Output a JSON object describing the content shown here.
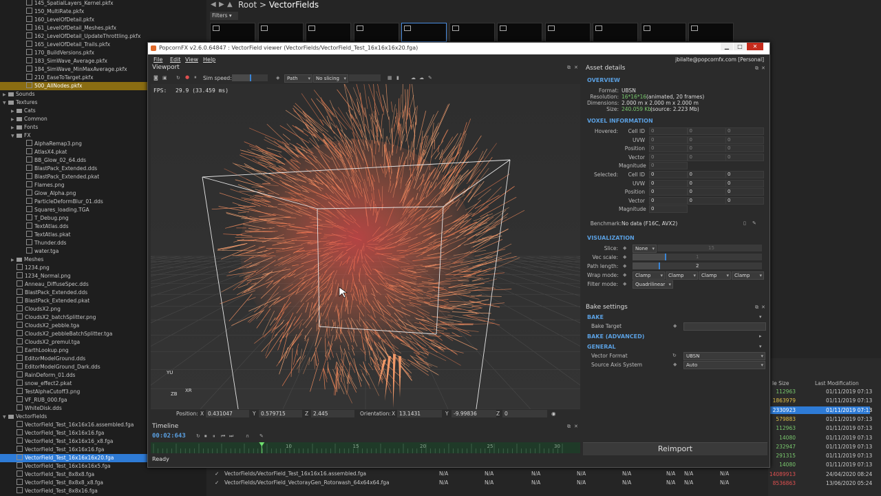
{
  "tree": {
    "items": [
      {
        "label": "145_SpatialLayers_Kernel.pkfx",
        "level": 3,
        "type": "file"
      },
      {
        "label": "150_MultiRate.pkfx",
        "level": 3,
        "type": "file"
      },
      {
        "label": "160_LevelOfDetail.pkfx",
        "level": 3,
        "type": "file"
      },
      {
        "label": "161_LevelOfDetail_Meshes.pkfx",
        "level": 3,
        "type": "file"
      },
      {
        "label": "162_LevelOfDetail_UpdateThrottling.pkfx",
        "level": 3,
        "type": "file"
      },
      {
        "label": "165_LevelOfDetail_Trails.pkfx",
        "level": 3,
        "type": "file"
      },
      {
        "label": "170_BuildVersions.pkfx",
        "level": 3,
        "type": "file"
      },
      {
        "label": "183_SimWave_Average.pkfx",
        "level": 3,
        "type": "file"
      },
      {
        "label": "184_SimWave_MinMaxAverage.pkfx",
        "level": 3,
        "type": "file"
      },
      {
        "label": "210_EaseToTarget.pkfx",
        "level": 3,
        "type": "file"
      },
      {
        "label": "500_AllNodes.pkfx",
        "level": 3,
        "type": "file",
        "state": "hl"
      },
      {
        "label": "Sounds",
        "level": 1,
        "type": "folder",
        "arrow": "▶"
      },
      {
        "label": "Textures",
        "level": 1,
        "type": "folder",
        "arrow": "▼"
      },
      {
        "label": "Cats",
        "level": 2,
        "type": "folder",
        "arrow": "▶"
      },
      {
        "label": "Common",
        "level": 2,
        "type": "folder",
        "arrow": "▶"
      },
      {
        "label": "Fonts",
        "level": 2,
        "type": "folder",
        "arrow": "▶"
      },
      {
        "label": "FX",
        "level": 2,
        "type": "folder",
        "arrow": "▼"
      },
      {
        "label": "AlphaRemap3.png",
        "level": 3,
        "type": "file"
      },
      {
        "label": "AtlasX4.pkat",
        "level": 3,
        "type": "file"
      },
      {
        "label": "BB_Glow_02_64.dds",
        "level": 3,
        "type": "file"
      },
      {
        "label": "BlastPack_Extended.dds",
        "level": 3,
        "type": "file"
      },
      {
        "label": "BlastPack_Extended.pkat",
        "level": 3,
        "type": "file"
      },
      {
        "label": "Flames.png",
        "level": 3,
        "type": "file"
      },
      {
        "label": "Glow_Alpha.png",
        "level": 3,
        "type": "file"
      },
      {
        "label": "ParticleDeformBlur_01.dds",
        "level": 3,
        "type": "file"
      },
      {
        "label": "Squares_loading.TGA",
        "level": 3,
        "type": "file"
      },
      {
        "label": "T_Debug.png",
        "level": 3,
        "type": "file"
      },
      {
        "label": "TextAtlas.dds",
        "level": 3,
        "type": "file"
      },
      {
        "label": "TextAtlas.pkat",
        "level": 3,
        "type": "file"
      },
      {
        "label": "Thunder.dds",
        "level": 3,
        "type": "file"
      },
      {
        "label": "water.tga",
        "level": 3,
        "type": "file"
      },
      {
        "label": "Meshes",
        "level": 2,
        "type": "folder",
        "arrow": "▶"
      },
      {
        "label": "1234.png",
        "level": 2,
        "type": "file"
      },
      {
        "label": "1234_Normal.png",
        "level": 2,
        "type": "file"
      },
      {
        "label": "Anneau_DiffuseSpec.dds",
        "level": 2,
        "type": "file"
      },
      {
        "label": "BlastPack_Extended.dds",
        "level": 2,
        "type": "file"
      },
      {
        "label": "BlastPack_Extended.pkat",
        "level": 2,
        "type": "file"
      },
      {
        "label": "CloudsX2.png",
        "level": 2,
        "type": "file"
      },
      {
        "label": "CloudsX2_batchSplitter.png",
        "level": 2,
        "type": "file"
      },
      {
        "label": "CloudsX2_pebble.tga",
        "level": 2,
        "type": "file"
      },
      {
        "label": "CloudsX2_pebbleBatchSplitter.tga",
        "level": 2,
        "type": "file"
      },
      {
        "label": "CloudsX2_premul.tga",
        "level": 2,
        "type": "file"
      },
      {
        "label": "EarthLookup.png",
        "level": 2,
        "type": "file"
      },
      {
        "label": "EditorModelGround.dds",
        "level": 2,
        "type": "file"
      },
      {
        "label": "EditorModelGround_Dark.dds",
        "level": 2,
        "type": "file"
      },
      {
        "label": "RainDeform_01.dds",
        "level": 2,
        "type": "file"
      },
      {
        "label": "snow_effect2.pkat",
        "level": 2,
        "type": "file"
      },
      {
        "label": "TestAlphaCutoff3.png",
        "level": 2,
        "type": "file"
      },
      {
        "label": "VF_RUB_000.fga",
        "level": 2,
        "type": "file"
      },
      {
        "label": "WhiteDisk.dds",
        "level": 2,
        "type": "file"
      },
      {
        "label": "VectorFields",
        "level": 1,
        "type": "folder",
        "arrow": "▼"
      },
      {
        "label": "VectorField_Test_16x16x16.assembled.fga",
        "level": 2,
        "type": "file"
      },
      {
        "label": "VectorField_Test_16x16x16.fga",
        "level": 2,
        "type": "file"
      },
      {
        "label": "VectorField_Test_16x16x16_x8.fga",
        "level": 2,
        "type": "file"
      },
      {
        "label": "VectorField_Test_16x16x16.fga",
        "level": 2,
        "type": "file"
      },
      {
        "label": "VectorField_Test_16x16x16x20.fga",
        "level": 2,
        "type": "file",
        "state": "sel"
      },
      {
        "label": "VectorField_Test_16x16x16x5.fga",
        "level": 2,
        "type": "file"
      },
      {
        "label": "VectorField_Test_8x8x8.fga",
        "level": 2,
        "type": "file"
      },
      {
        "label": "VectorField_Test_8x8x8_x8.fga",
        "level": 2,
        "type": "file"
      },
      {
        "label": "VectorField_Test_8x8x16.fga",
        "level": 2,
        "type": "file"
      }
    ]
  },
  "browser": {
    "breadcrumb_root": "Root",
    "breadcrumb_sep": ">",
    "breadcrumb_current": "VectorFields",
    "filters_label": "Filters",
    "table_headers": {
      "size": "le Size",
      "modified": "Last Modification"
    },
    "rows": [
      {
        "size": "112963",
        "date": "01/11/2019 07:13",
        "color": "#7ac96e"
      },
      {
        "size": "1863979",
        "date": "01/11/2019 07:13",
        "color": "#e0c04a"
      },
      {
        "size": "2330923",
        "date": "01/11/2019 07:13",
        "color": "#ffffff",
        "sel": true
      },
      {
        "size": "579883",
        "date": "01/11/2019 07:13",
        "color": "#e0c04a"
      },
      {
        "size": "112963",
        "date": "01/11/2019 07:13",
        "color": "#7ac96e"
      },
      {
        "size": "14080",
        "date": "01/11/2019 07:13",
        "color": "#7ac96e"
      },
      {
        "size": "232947",
        "date": "01/11/2019 07:13",
        "color": "#7ac96e"
      },
      {
        "size": "291315",
        "date": "01/11/2019 07:13",
        "color": "#7ac96e"
      },
      {
        "size": "14080",
        "date": "01/11/2019 07:13",
        "color": "#7ac96e"
      },
      {
        "size": "14089913",
        "date": "24/04/2020 08:24",
        "color": "#e05050"
      },
      {
        "size": "8536863",
        "date": "13/06/2020 05:24",
        "color": "#e05050"
      }
    ],
    "bottom_rows": [
      {
        "path": "VectorFields/VectorField_Test_16x16x16.assembled.fga",
        "na": [
          "N/A",
          "N/A",
          "N/A",
          "N/A",
          "N/A",
          "N/A",
          "N/A",
          "N/A",
          "N/A",
          "N/A"
        ]
      },
      {
        "path": "VectorFields/VectorField_VectorayGen_Rotorwash_64x64x64.fga",
        "na": [
          "N/A",
          "N/A",
          "N/A",
          "N/A",
          "N/A",
          "N/A",
          "N/A",
          "N/A",
          "N/A",
          "N/A"
        ]
      }
    ]
  },
  "window": {
    "title": "PopcornFX v2.6.0.64847 : VectorField viewer (VectorFields/VectorField_Test_16x16x16x20.fga)",
    "menu": [
      "File",
      "Edit",
      "View",
      "Help"
    ],
    "user": "jbilalte@popcornfx.com [Personal]",
    "status": "Ready"
  },
  "viewport": {
    "title": "Viewport",
    "sim_speed_label": "Sim speed:",
    "path_combo": "Path",
    "slicing_combo": "No slicing",
    "fps_label": "FPS:",
    "fps_value": "29.9 (33.459 ms)",
    "axis_labels": {
      "y": "YU",
      "z": "ZB",
      "x": "XR"
    },
    "position_label": "Position:",
    "pos": {
      "x": "0.431047",
      "y": "0.579715",
      "z": "2.445"
    },
    "orientation_label": "Orientation:",
    "ori": {
      "x": "13.1431",
      "y": "-9.99836",
      "z": "0"
    },
    "axis_letters": [
      "X",
      "Y",
      "Z"
    ]
  },
  "timeline": {
    "title": "Timeline",
    "time": "00:02:643",
    "ticks": [
      "10",
      "15",
      "20",
      "25",
      "30"
    ],
    "marker_position": 0.55
  },
  "asset": {
    "title": "Asset details",
    "overview_header": "OVERVIEW",
    "format_label": "Format:",
    "format_value": "UBSN",
    "resolution_label": "Resolution:",
    "resolution_value": "16*16*16",
    "resolution_note": "(animated, 20 frames)",
    "dimensions_label": "Dimensions:",
    "dimensions_value": "2.000 m x 2.000 m x 2.000 m",
    "size_label": "Size:",
    "size_value": "240.059 Kb",
    "size_note": "(source: 2.223 Mb)",
    "voxel_header": "VOXEL INFORMATION",
    "hovered_label": "Hovered:",
    "selected_label": "Selected:",
    "voxel_fields": [
      "Cell ID",
      "UVW",
      "Position",
      "Vector",
      "Magnitude"
    ],
    "hovered_values": [
      "0",
      "0",
      "0"
    ],
    "selected_values": [
      "0",
      "0",
      "0"
    ],
    "benchmark_label": "Benchmark:",
    "benchmark_value": "No data (F16C, AVX2)",
    "vis_header": "VISUALIZATION",
    "slice_label": "Slice:",
    "slice_combo": "None",
    "slice_value": "15",
    "vecscale_label": "Vec scale:",
    "vecscale_value": "1",
    "vecscale_level": 0.25,
    "pathlength_label": "Path length:",
    "pathlength_value": "2",
    "pathlength_level": 0.2,
    "wrap_label": "Wrap mode:",
    "wrap_values": [
      "Clamp",
      "Clamp",
      "Clamp",
      "Clamp"
    ],
    "filter_label": "Filter mode:",
    "filter_value": "Quadrilinear"
  },
  "bake": {
    "title": "Bake settings",
    "bake_header": "BAKE",
    "bake_target_label": "Bake Target",
    "advanced_header": "BAKE (ADVANCED)",
    "general_header": "GENERAL",
    "vector_format_label": "Vector Format",
    "vector_format_value": "UBSN",
    "source_axis_label": "Source Axis System",
    "source_axis_value": "Auto",
    "reimport_label": "Reimport"
  },
  "colors": {
    "accent": "#5a9fe0",
    "selection": "#2e7bd6",
    "highlight": "#8a6d12",
    "arrows": "#f08a5a"
  }
}
